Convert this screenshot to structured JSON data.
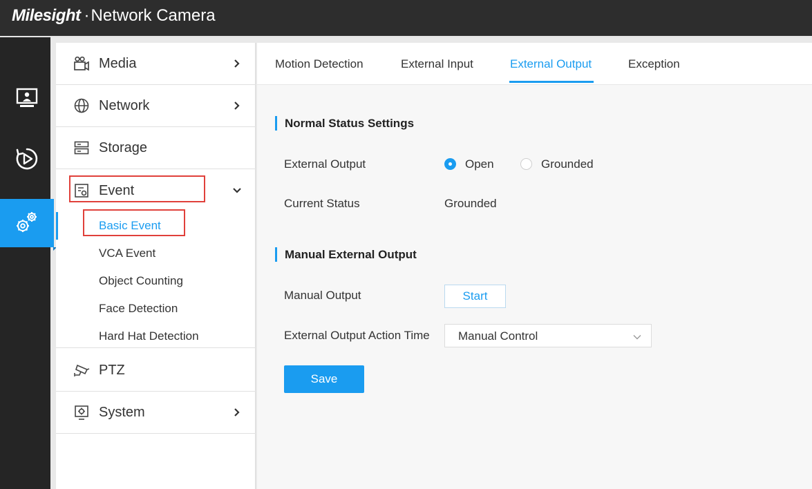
{
  "header": {
    "brand_logo": "Milesight",
    "separator": "·",
    "product": "Network Camera"
  },
  "leftbar": {
    "items": [
      {
        "icon": "monitor-icon",
        "active": false
      },
      {
        "icon": "playback-icon",
        "active": false
      },
      {
        "icon": "settings-icon",
        "active": true
      }
    ]
  },
  "menu": {
    "items": [
      {
        "label": "Media",
        "icon": "camera-icon",
        "arrow": "right"
      },
      {
        "label": "Network",
        "icon": "globe-icon",
        "arrow": "right"
      },
      {
        "label": "Storage",
        "icon": "storage-icon",
        "arrow": "none"
      },
      {
        "label": "Event",
        "icon": "event-icon",
        "arrow": "down"
      },
      {
        "label": "PTZ",
        "icon": "ptz-camera-icon",
        "arrow": "none"
      },
      {
        "label": "System",
        "icon": "system-icon",
        "arrow": "right"
      }
    ],
    "event_subitems": [
      "Basic Event",
      "VCA Event",
      "Object Counting",
      "Face Detection",
      "Hard Hat Detection"
    ],
    "active_subitem": "Basic Event"
  },
  "tabs": [
    {
      "label": "Motion Detection",
      "active": false
    },
    {
      "label": "External Input",
      "active": false
    },
    {
      "label": "External Output",
      "active": true
    },
    {
      "label": "Exception",
      "active": false
    }
  ],
  "normal_status": {
    "title": "Normal Status Settings",
    "external_output_label": "External Output",
    "options": [
      "Open",
      "Grounded"
    ],
    "selected": "Open",
    "current_status_label": "Current Status",
    "current_status_value": "Grounded"
  },
  "manual_output": {
    "title": "Manual External Output",
    "manual_output_label": "Manual Output",
    "start_label": "Start",
    "action_time_label": "External Output Action Time",
    "action_time_value": "Manual Control"
  },
  "save_label": "Save",
  "colors": {
    "accent": "#1a9cf0",
    "header_bg": "#2d2d2d",
    "sidebar_bg": "#252525",
    "highlight_box": "#e0403a"
  }
}
